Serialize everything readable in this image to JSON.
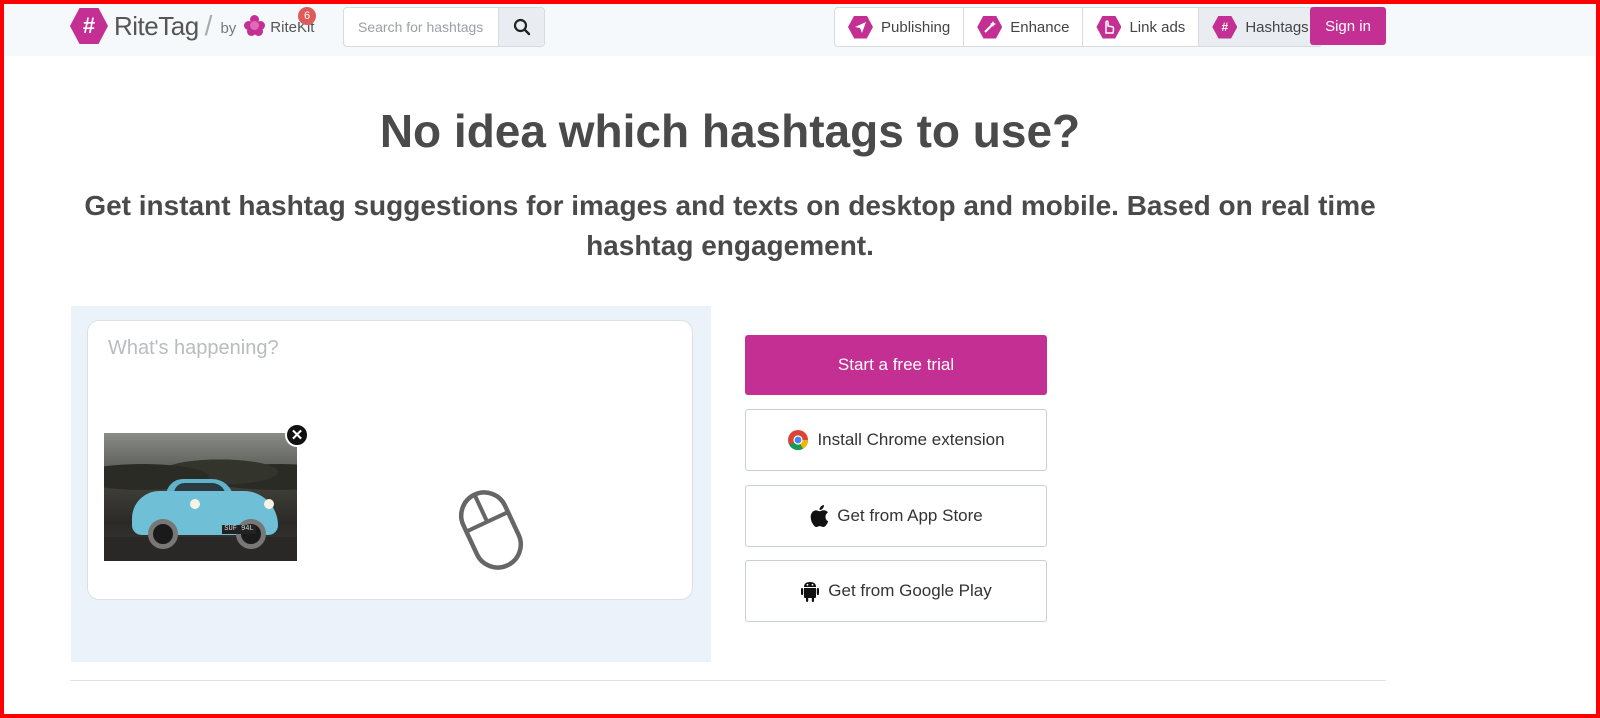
{
  "header": {
    "logo": {
      "text": "RiteTag",
      "symbol": "#",
      "by": "by",
      "parent": "RiteKit",
      "notification_count": "6"
    },
    "search": {
      "placeholder": "Search for hashtags",
      "value": ""
    },
    "nav": [
      {
        "label": "Publishing",
        "icon": "paper-plane-icon"
      },
      {
        "label": "Enhance",
        "icon": "magic-wand-icon"
      },
      {
        "label": "Link ads",
        "icon": "hand-pointer-icon"
      },
      {
        "label": "Hashtags",
        "icon": "hash-icon",
        "active": true
      }
    ],
    "signin_label": "Sign in"
  },
  "hero": {
    "title": "No idea which hashtags to use?",
    "subtitle": "Get instant hashtag suggestions for images and texts on desktop and mobile. Based on real time hashtag engagement."
  },
  "composer": {
    "placeholder": "What's happening?",
    "value": "",
    "attached_image": {
      "plate_text": "SUF 94L",
      "icon": "close-icon"
    },
    "scroll_hint_icon": "mouse-icon"
  },
  "actions": {
    "trial_label": "Start a free trial",
    "chrome_label": "Install Chrome extension",
    "appstore_label": "Get from App Store",
    "googleplay_label": "Get from Google Play"
  },
  "colors": {
    "brand": "#c32f93",
    "header_bg": "#f6f9fc",
    "panel_bg": "#ecf2f9",
    "text": "#4a4a4a",
    "badge": "#e15a5a"
  }
}
